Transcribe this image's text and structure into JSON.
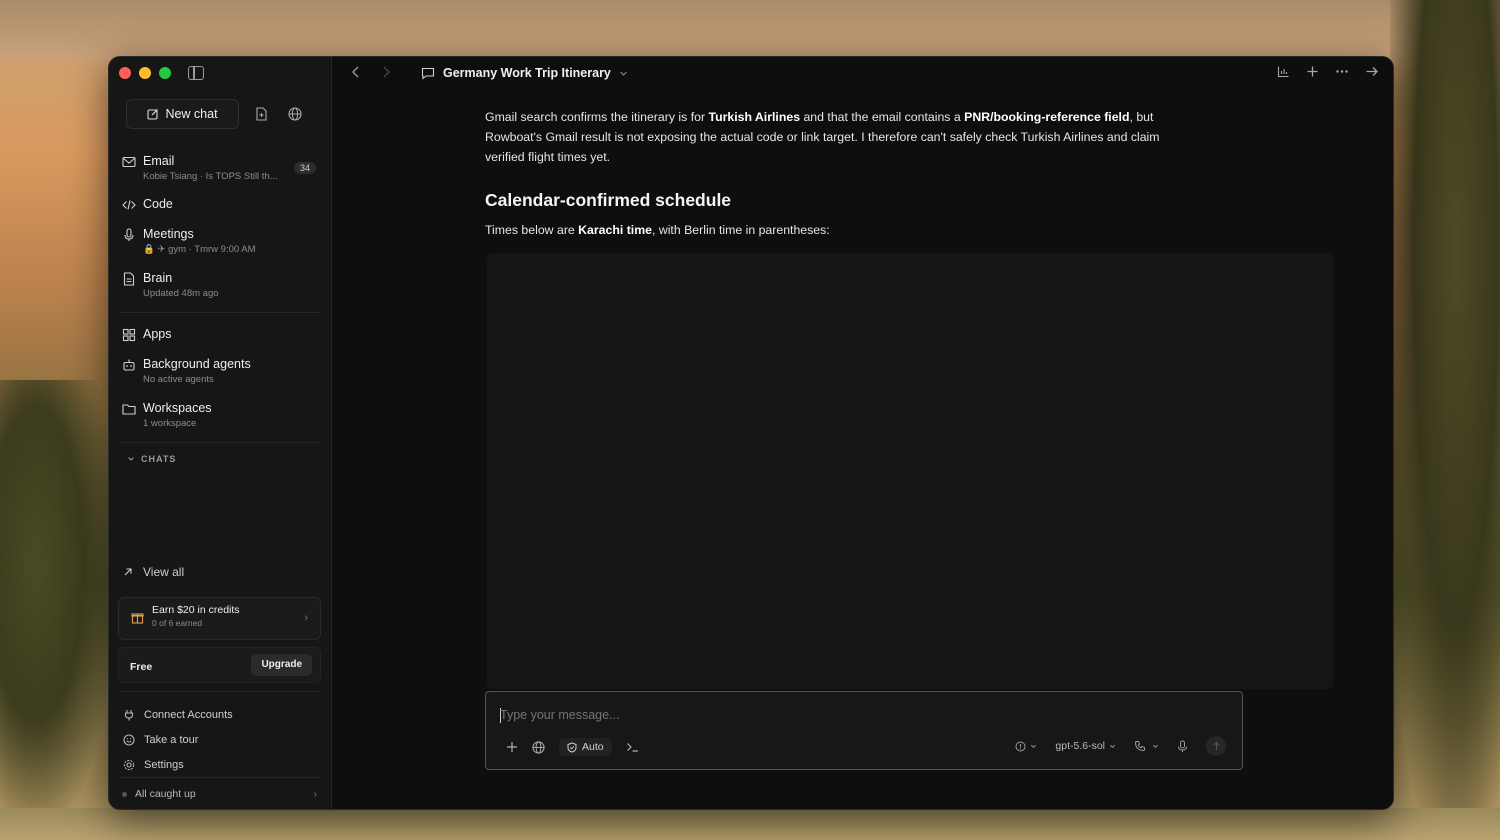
{
  "window": {
    "title": "Germany Work Trip Itinerary"
  },
  "sidebar": {
    "new_chat_label": "New chat",
    "items": [
      {
        "label": "Email",
        "sub": "Kobie Tsiang · Is TOPS Still th...",
        "badge": "34",
        "icon": "mail-icon"
      },
      {
        "label": "Code",
        "sub": "",
        "icon": "code-icon"
      },
      {
        "label": "Meetings",
        "sub": "🔒 ✈ gym · Tmrw 9:00 AM",
        "icon": "microphone-icon"
      },
      {
        "label": "Brain",
        "sub": "Updated 48m ago",
        "icon": "document-icon"
      },
      {
        "label": "Apps",
        "sub": "",
        "icon": "grid-icon"
      },
      {
        "label": "Background agents",
        "sub": "No active agents",
        "icon": "robot-icon"
      },
      {
        "label": "Workspaces",
        "sub": "1 workspace",
        "icon": "folder-icon"
      }
    ],
    "chats_header": "CHATS",
    "view_all": "View all",
    "credits": {
      "title": "Earn $20 in credits",
      "sub": "0 of 6 earned"
    },
    "plan": {
      "name": "Free",
      "upgrade": "Upgrade"
    },
    "bottom_links": [
      {
        "label": "Connect Accounts",
        "icon": "plug-icon"
      },
      {
        "label": "Take a tour",
        "icon": "smile-icon"
      },
      {
        "label": "Settings",
        "icon": "gear-icon"
      }
    ],
    "status": "All caught up"
  },
  "message": {
    "para1_a": "Gmail search confirms the itinerary is for ",
    "para1_b": "Turkish Airlines",
    "para1_c": " and that the email contains a ",
    "para1_d": "PNR/booking-reference field",
    "para1_e": ", but Rowboat's Gmail result is not exposing the actual code or link target. I therefore can't safely check Turkish Airlines and claim verified flight times yet.",
    "heading": "Calendar-confirmed schedule",
    "para2_a": "Times below are ",
    "para2_b": "Karachi time",
    "para2_c": ", with Berlin time in parentheses:"
  },
  "composer": {
    "placeholder": "Type your message...",
    "auto_label": "Auto",
    "model": "gpt-5.6-sol"
  }
}
